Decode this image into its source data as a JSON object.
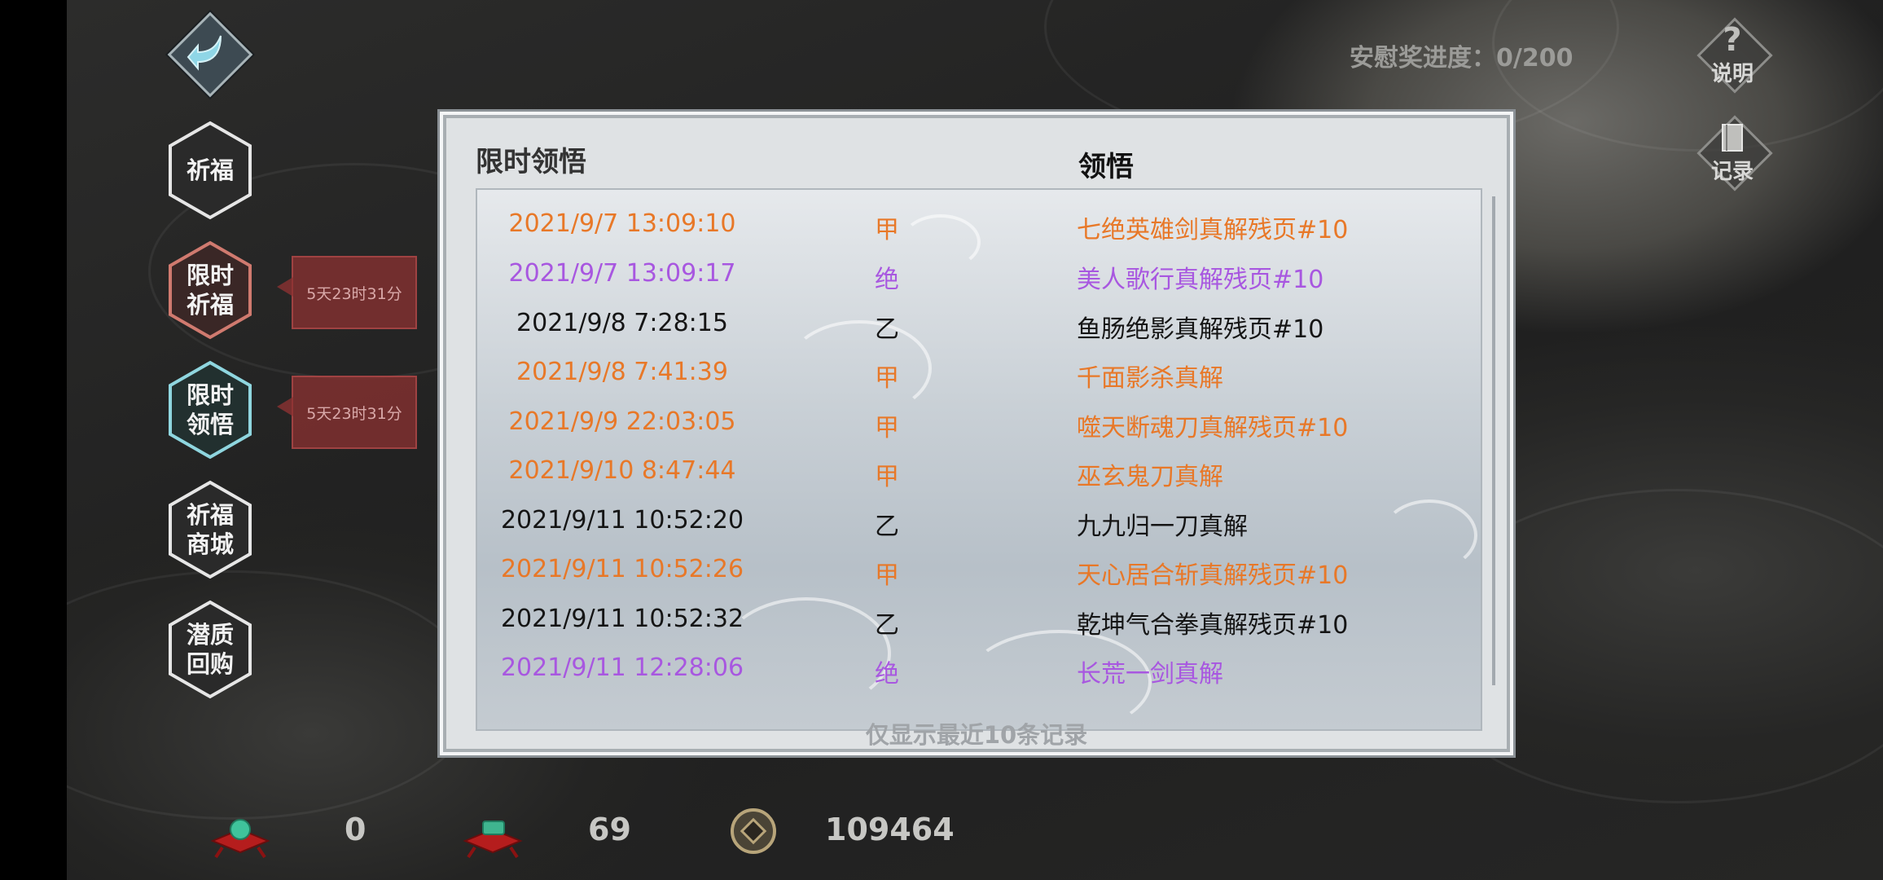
{
  "sidebar": {
    "items": [
      {
        "label": "祈福",
        "accent": "#e6e6e6"
      },
      {
        "label": "限时祈福",
        "accent": "#d07a6f"
      },
      {
        "label": "限时领悟",
        "accent": "#8fd6df"
      },
      {
        "label": "祈福商城",
        "accent": "#e6e6e6"
      },
      {
        "label": "潜质回购",
        "accent": "#e6e6e6"
      }
    ],
    "timers": [
      "5天23时31分",
      "5天23时31分"
    ]
  },
  "top": {
    "consolation_progress": "安慰奖进度：0/200",
    "help_label": "说明",
    "record_label": "记录"
  },
  "dialog": {
    "title": "限时领悟",
    "heading": "领悟",
    "footer_note": "仅显示最近10条记录",
    "rows": [
      {
        "time": "2021/9/7 13:09:10",
        "grade": "甲",
        "name": "七绝英雄剑真解残页#10",
        "color": "#e87828"
      },
      {
        "time": "2021/9/7 13:09:17",
        "grade": "绝",
        "name": "美人歌行真解残页#10",
        "color": "#a857e0"
      },
      {
        "time": "2021/9/8 7:28:15",
        "grade": "乙",
        "name": "鱼肠绝影真解残页#10",
        "color": "#151515"
      },
      {
        "time": "2021/9/8 7:41:39",
        "grade": "甲",
        "name": "千面影杀真解",
        "color": "#e87828"
      },
      {
        "time": "2021/9/9 22:03:05",
        "grade": "甲",
        "name": "噬天断魂刀真解残页#10",
        "color": "#e87828"
      },
      {
        "time": "2021/9/10 8:47:44",
        "grade": "甲",
        "name": "巫玄鬼刀真解",
        "color": "#e87828"
      },
      {
        "time": "2021/9/11 10:52:20",
        "grade": "乙",
        "name": "九九归一刀真解",
        "color": "#151515"
      },
      {
        "time": "2021/9/11 10:52:26",
        "grade": "甲",
        "name": "天心居合斩真解残页#10",
        "color": "#e87828"
      },
      {
        "time": "2021/9/11 10:52:32",
        "grade": "乙",
        "name": "乾坤气合拳真解残页#10",
        "color": "#151515"
      },
      {
        "time": "2021/9/11 12:28:06",
        "grade": "绝",
        "name": "长荒一剑真解",
        "color": "#a857e0"
      }
    ]
  },
  "currencies": [
    {
      "icon": "jade-cushion-icon",
      "value": "0"
    },
    {
      "icon": "scroll-cushion-icon",
      "value": "69"
    },
    {
      "icon": "coin-icon",
      "value": "109464"
    }
  ]
}
